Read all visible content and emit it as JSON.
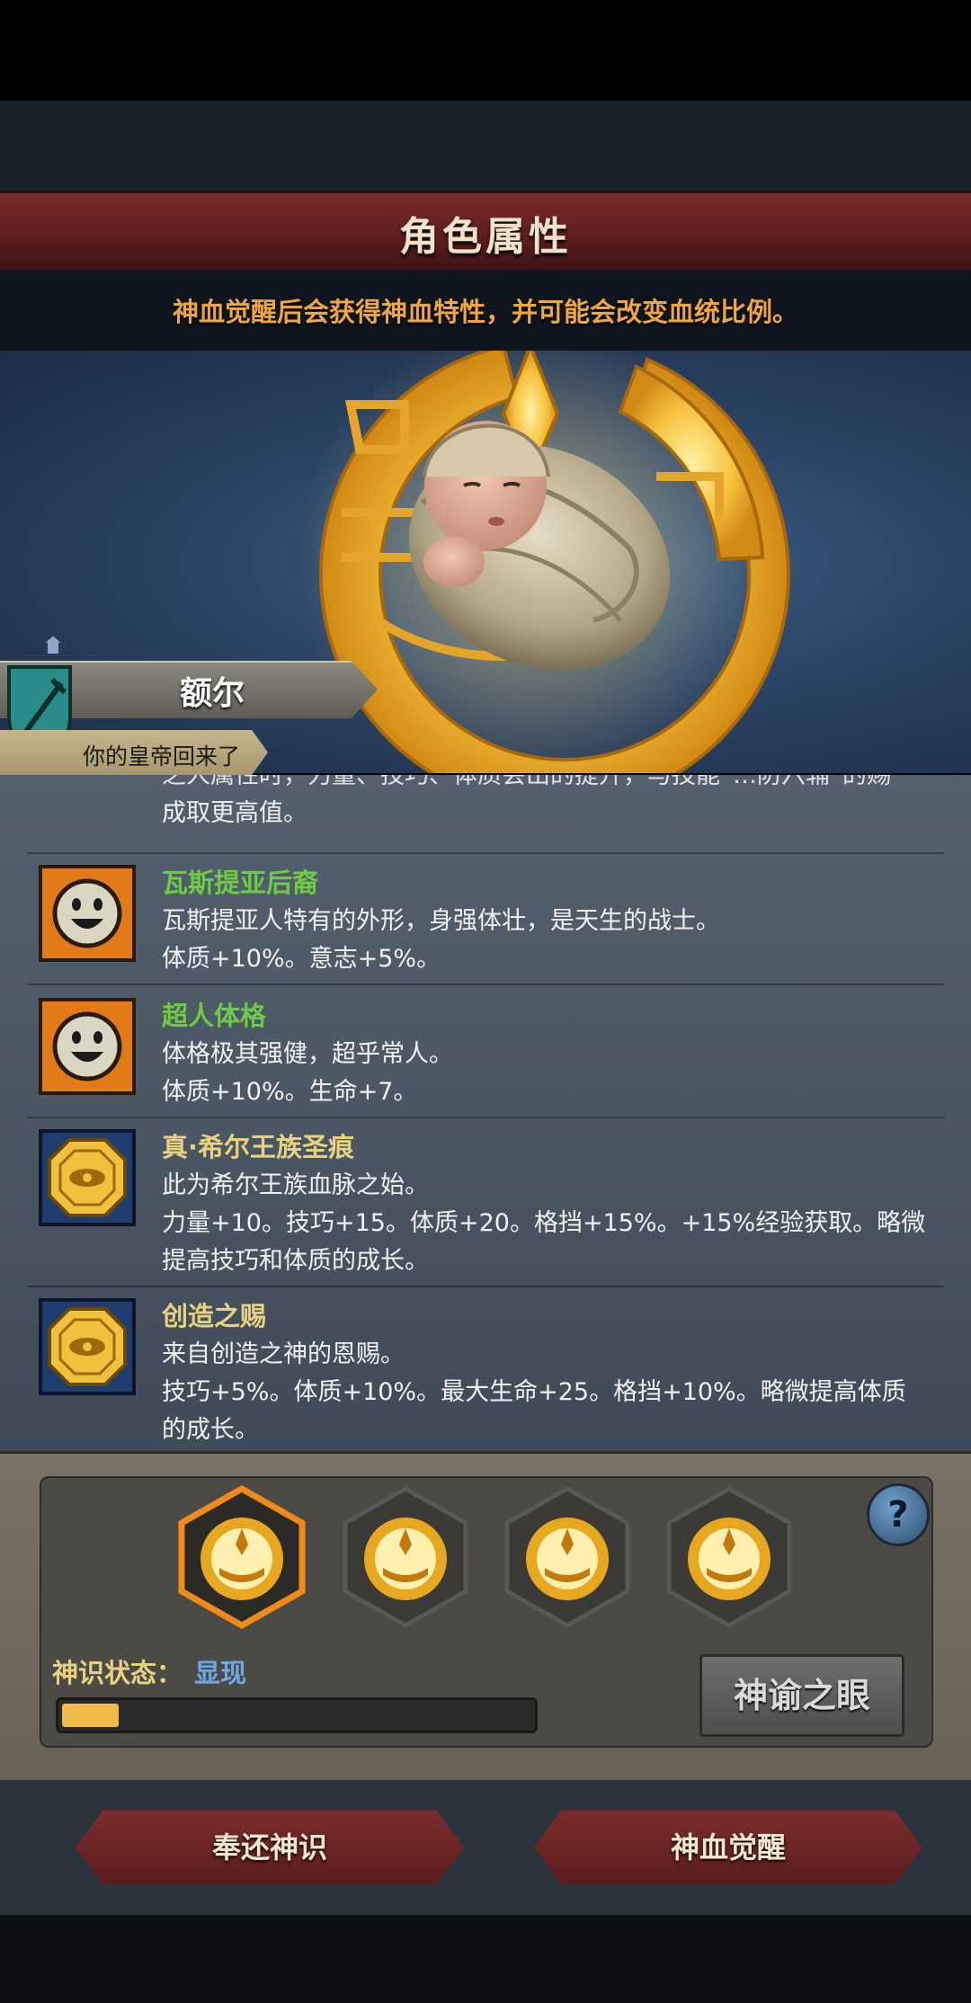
{
  "header": {
    "title": "角色属性"
  },
  "hint": {
    "text": "神血觉醒后会获得神血特性，并可能会改变血统比例。"
  },
  "character": {
    "name": "额尔",
    "title": "你的皇帝回来了"
  },
  "traits_cut": {
    "line1": "之人属性时，力量、技巧、体质会出的提升，与技能“…防六辅”的赐",
    "line2": "成取更高值。"
  },
  "traits": [
    {
      "name": "瓦斯提亚后裔",
      "icon": "smiley-icon",
      "desc": [
        "瓦斯提亚人特有的外形，身强体壮，是天生的战士。",
        "体质+10%。意志+5%。"
      ]
    },
    {
      "name": "超人体格",
      "icon": "smiley-icon",
      "desc": [
        "体格极其强健，超乎常人。",
        "体质+10%。生命+7。"
      ]
    },
    {
      "name": "真·希尔王族圣痕",
      "icon": "gold-coin-icon",
      "desc": [
        "此为希尔王族血脉之始。",
        "力量+10。技巧+15。体质+20。格挡+15%。+15%经验获取。略微",
        "提高技巧和体质的成长。"
      ]
    },
    {
      "name": "创造之赐",
      "icon": "gold-coin-icon",
      "desc": [
        "来自创造之神的恩赐。",
        "技巧+5%。体质+10%。最大生命+25。格挡+10%。略微提高体质",
        "的成长。"
      ]
    }
  ],
  "awakening": {
    "status_label": "神识状态：",
    "status_value": "显现",
    "progress": 0.12,
    "oracle_button": "神谕之眼",
    "help": "?"
  },
  "buttons": {
    "return": "奉还神识",
    "awaken": "神血觉醒"
  },
  "colors": {
    "accent_gold": "#f2ba48",
    "green_trait": "#6fcb44",
    "yellow_trait": "#e9d27f",
    "header_red": "#6a2324"
  }
}
